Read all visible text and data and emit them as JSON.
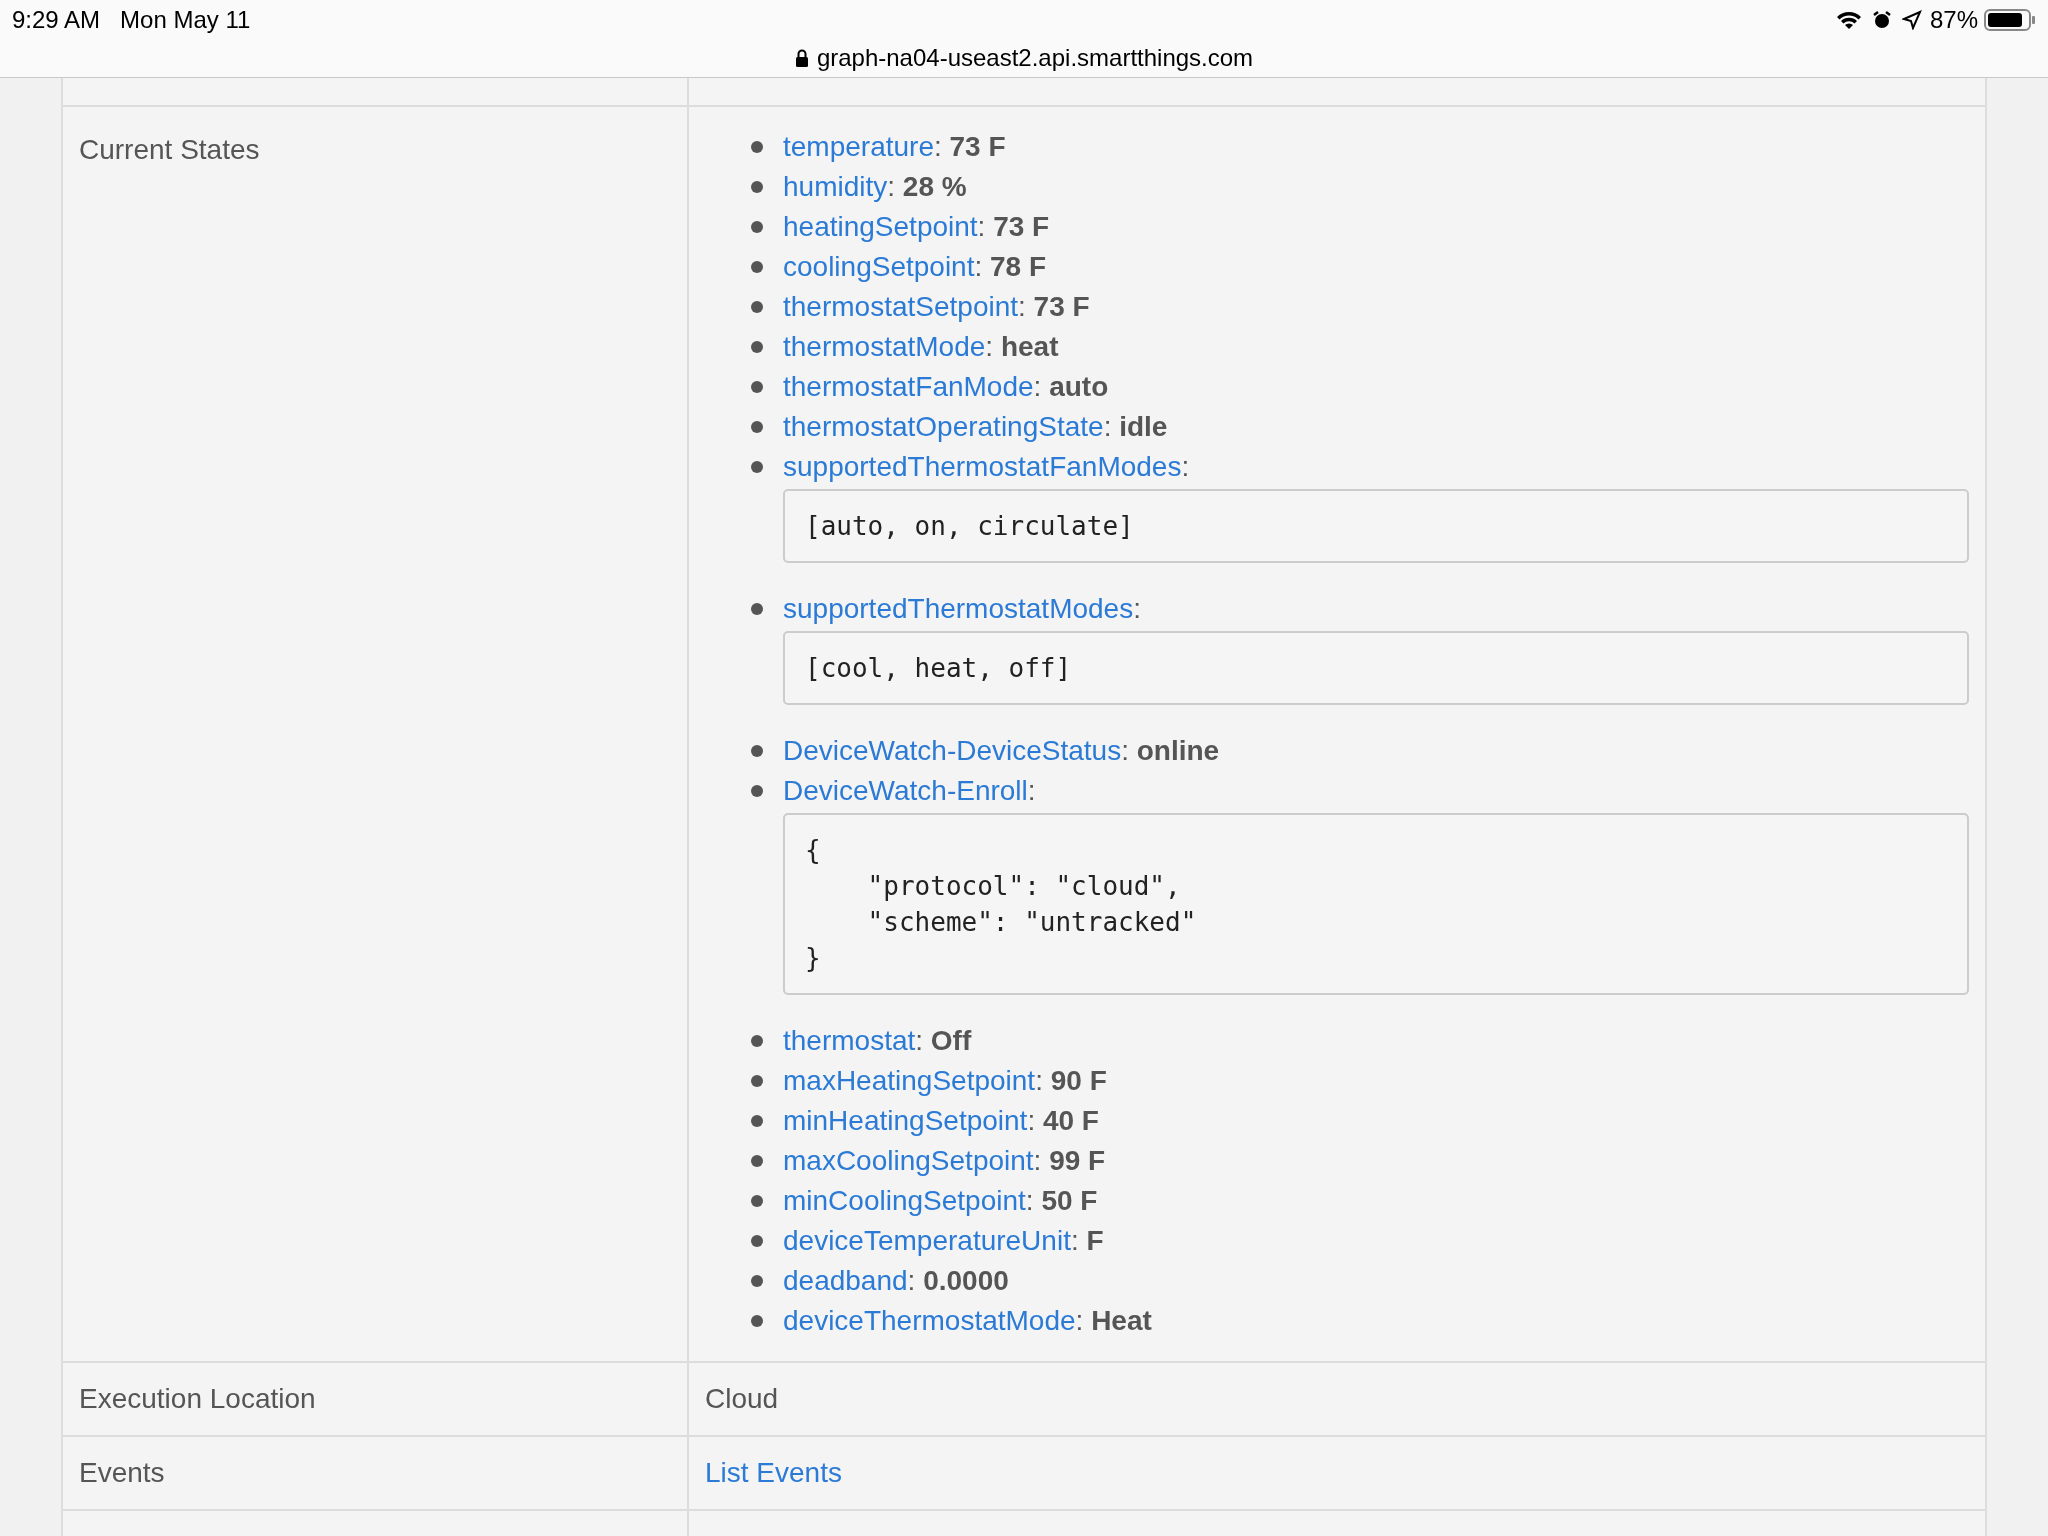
{
  "status_bar": {
    "time": "9:29 AM",
    "date": "Mon May 11",
    "battery": "87%"
  },
  "address_bar": {
    "url": "graph-na04-useast2.api.smartthings.com"
  },
  "table": {
    "separator": ":",
    "rows": [
      {
        "kind": "states",
        "label": "Current States",
        "states": [
          {
            "kind": "value",
            "name": "temperature",
            "value": "73 F"
          },
          {
            "kind": "value",
            "name": "humidity",
            "value": "28 %"
          },
          {
            "kind": "value",
            "name": "heatingSetpoint",
            "value": "73 F"
          },
          {
            "kind": "value",
            "name": "coolingSetpoint",
            "value": "78 F"
          },
          {
            "kind": "value",
            "name": "thermostatSetpoint",
            "value": "73 F"
          },
          {
            "kind": "value",
            "name": "thermostatMode",
            "value": "heat"
          },
          {
            "kind": "value",
            "name": "thermostatFanMode",
            "value": "auto"
          },
          {
            "kind": "value",
            "name": "thermostatOperatingState",
            "value": "idle"
          },
          {
            "kind": "code",
            "name": "supportedThermostatFanModes",
            "value": "[auto, on, circulate]"
          },
          {
            "kind": "code",
            "name": "supportedThermostatModes",
            "value": "[cool, heat, off]"
          },
          {
            "kind": "value",
            "name": "DeviceWatch-DeviceStatus",
            "value": "online"
          },
          {
            "kind": "code",
            "name": "DeviceWatch-Enroll",
            "value": "{\n    \"protocol\": \"cloud\",\n    \"scheme\": \"untracked\"\n}"
          },
          {
            "kind": "value",
            "name": "thermostat",
            "value": "Off"
          },
          {
            "kind": "value",
            "name": "maxHeatingSetpoint",
            "value": "90 F"
          },
          {
            "kind": "value",
            "name": "minHeatingSetpoint",
            "value": "40 F"
          },
          {
            "kind": "value",
            "name": "maxCoolingSetpoint",
            "value": "99 F"
          },
          {
            "kind": "value",
            "name": "minCoolingSetpoint",
            "value": "50 F"
          },
          {
            "kind": "value",
            "name": "deviceTemperatureUnit",
            "value": "F"
          },
          {
            "kind": "value",
            "name": "deadband",
            "value": "0.0000"
          },
          {
            "kind": "value",
            "name": "deviceThermostatMode",
            "value": "Heat"
          }
        ]
      },
      {
        "kind": "text",
        "label": "Execution Location",
        "value": "Cloud"
      },
      {
        "kind": "link",
        "label": "Events",
        "value": "List Events"
      }
    ]
  }
}
